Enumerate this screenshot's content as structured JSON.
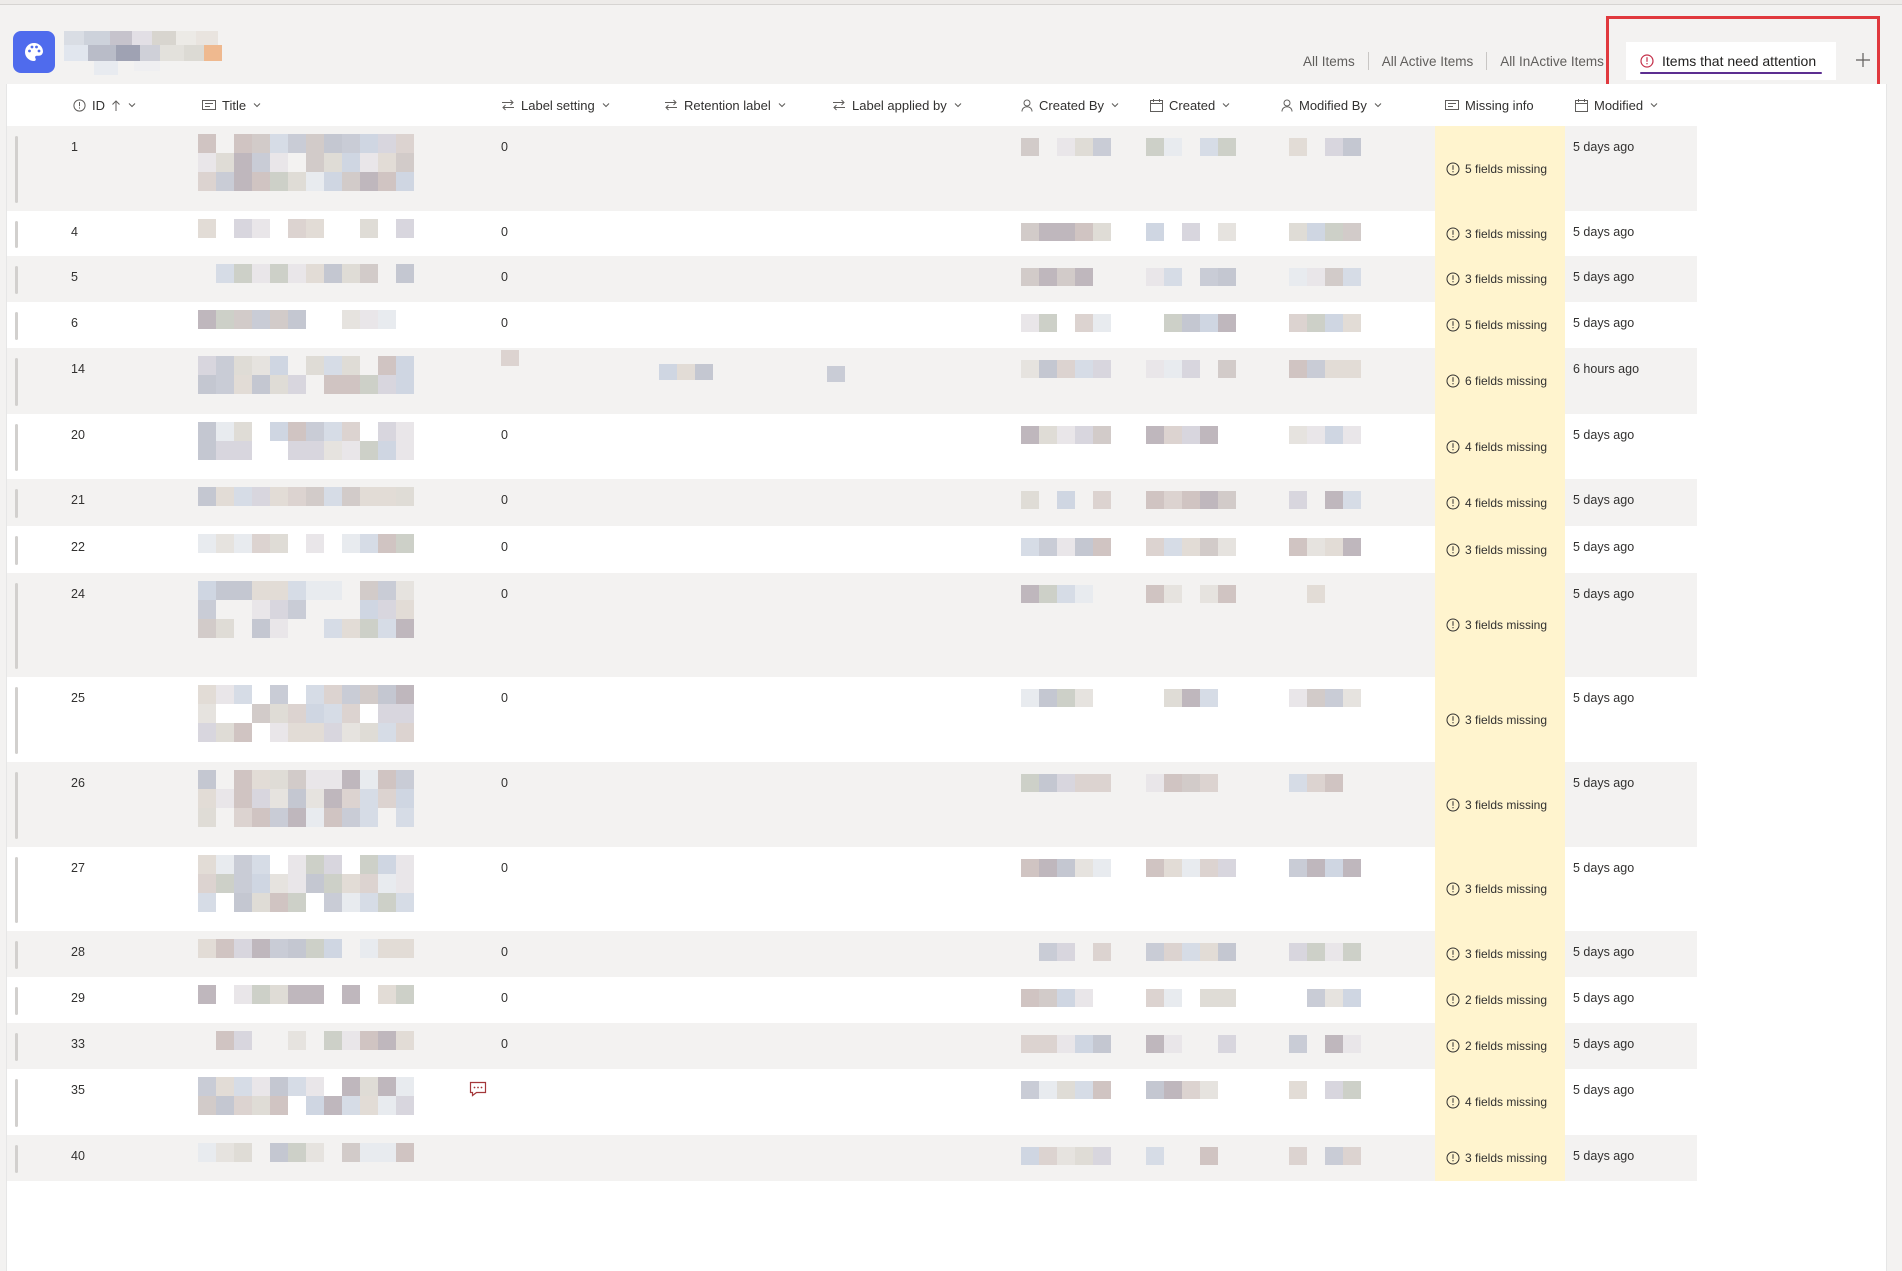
{
  "views": {
    "tabs": [
      "All Items",
      "All Active Items",
      "All InActive Items"
    ],
    "active_tab": "Items that need attention",
    "add_label": "+"
  },
  "columns": {
    "id": "ID",
    "title": "Title",
    "label_setting": "Label setting",
    "retention_label": "Retention label",
    "label_applied_by": "Label applied by",
    "created_by": "Created By",
    "created": "Created",
    "modified_by": "Modified By",
    "missing_info": "Missing info",
    "modified": "Modified"
  },
  "rows": [
    {
      "id": "1",
      "label_setting": "0",
      "missing": "5 fields missing",
      "modified": "5 days ago"
    },
    {
      "id": "4",
      "label_setting": "0",
      "missing": "3 fields missing",
      "modified": "5 days ago"
    },
    {
      "id": "5",
      "label_setting": "0",
      "missing": "3 fields missing",
      "modified": "5 days ago"
    },
    {
      "id": "6",
      "label_setting": "0",
      "missing": "5 fields missing",
      "modified": "5 days ago"
    },
    {
      "id": "14",
      "label_setting": "",
      "missing": "6 fields missing",
      "modified": "6 hours ago"
    },
    {
      "id": "20",
      "label_setting": "0",
      "missing": "4 fields missing",
      "modified": "5 days ago"
    },
    {
      "id": "21",
      "label_setting": "0",
      "missing": "4 fields missing",
      "modified": "5 days ago"
    },
    {
      "id": "22",
      "label_setting": "0",
      "missing": "3 fields missing",
      "modified": "5 days ago"
    },
    {
      "id": "24",
      "label_setting": "0",
      "missing": "3 fields missing",
      "modified": "5 days ago"
    },
    {
      "id": "25",
      "label_setting": "0",
      "missing": "3 fields missing",
      "modified": "5 days ago"
    },
    {
      "id": "26",
      "label_setting": "0",
      "missing": "3 fields missing",
      "modified": "5 days ago"
    },
    {
      "id": "27",
      "label_setting": "0",
      "missing": "3 fields missing",
      "modified": "5 days ago"
    },
    {
      "id": "28",
      "label_setting": "0",
      "missing": "3 fields missing",
      "modified": "5 days ago"
    },
    {
      "id": "29",
      "label_setting": "0",
      "missing": "2 fields missing",
      "modified": "5 days ago"
    },
    {
      "id": "33",
      "label_setting": "0",
      "missing": "2 fields missing",
      "modified": "5 days ago"
    },
    {
      "id": "35",
      "label_setting": "",
      "missing": "4 fields missing",
      "modified": "5 days ago"
    },
    {
      "id": "40",
      "label_setting": "",
      "missing": "3 fields missing",
      "modified": "5 days ago"
    }
  ],
  "colors": {
    "app_icon": "#4f6bed",
    "active_underline": "#5c2e91",
    "highlight_box": "#e0393e",
    "missing_info_bg": "#fff4ce",
    "warning_icon": "#c4314b"
  },
  "icons": {
    "app": "palette-icon",
    "active_tab": "warning-circle-icon",
    "missing": "info-circle-icon",
    "comment": "comment-icon"
  }
}
